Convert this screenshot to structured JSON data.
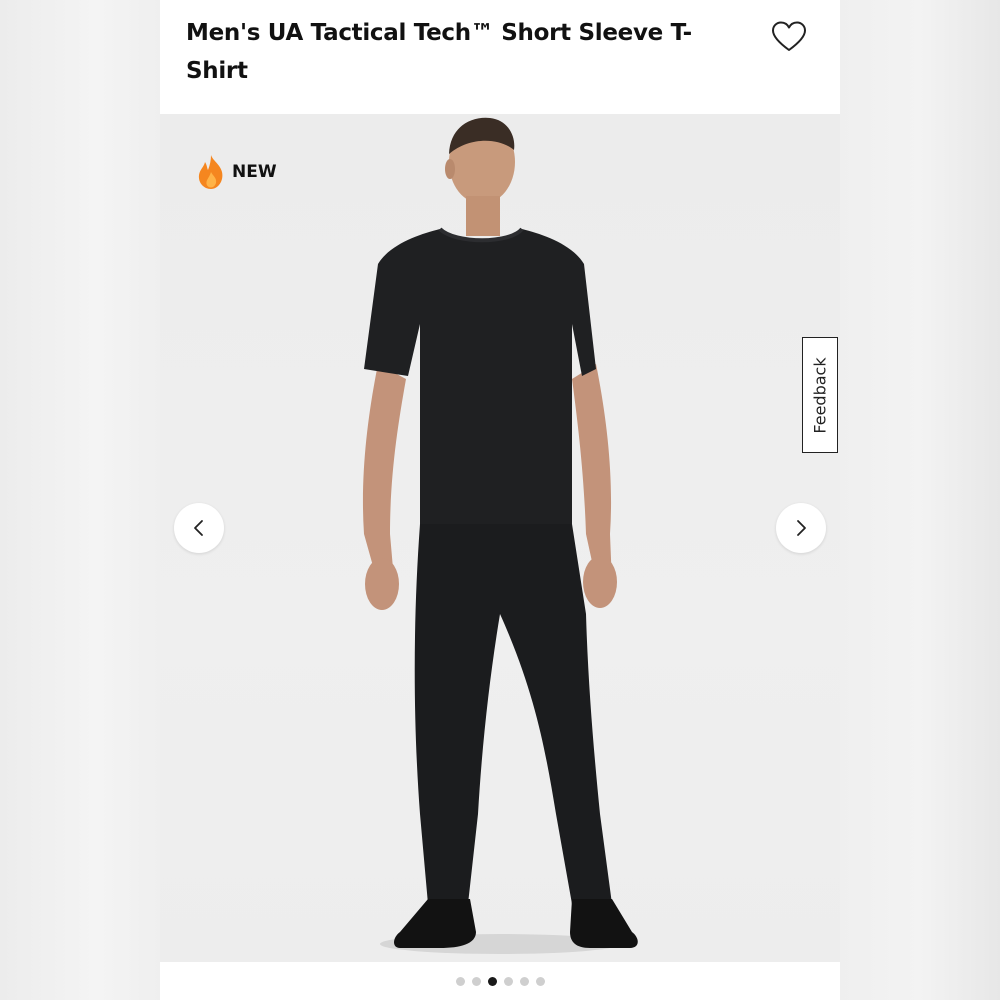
{
  "product": {
    "title": "Men's UA Tactical Tech™ Short Sleeve T-Shirt",
    "badge_label": "NEW",
    "badge_icon": "flame-icon",
    "wishlist_icon": "heart-outline-icon"
  },
  "gallery": {
    "prev_icon": "chevron-left-icon",
    "next_icon": "chevron-right-icon",
    "image_count": 6,
    "active_index": 3
  },
  "feedback": {
    "label": "Feedback"
  },
  "colors": {
    "badge_flame": "#f5861f",
    "active_dot": "#1a1a1a",
    "inactive_dot": "#cfcfcf"
  }
}
